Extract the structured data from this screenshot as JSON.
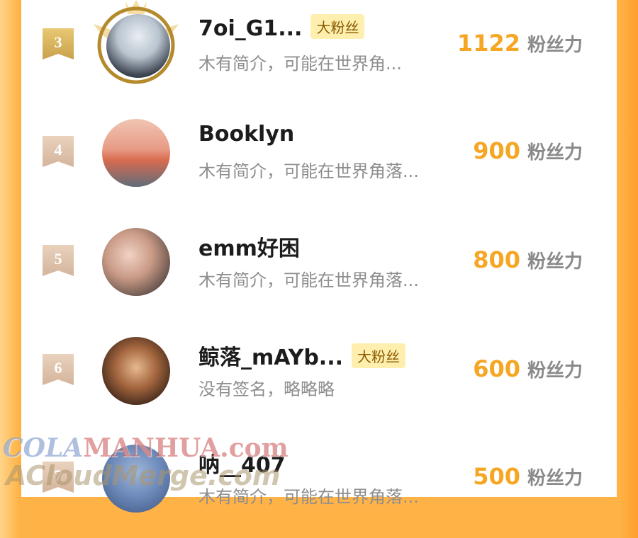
{
  "score_unit": "粉丝力",
  "badge_label": "大粉丝",
  "rows": [
    {
      "rank": "3",
      "name": "7oi_G1...",
      "bio": "木有简介，可能在世界角...",
      "score": "1122",
      "badge": true
    },
    {
      "rank": "4",
      "name": "Booklyn",
      "bio": "木有简介，可能在世界角落...",
      "score": "900",
      "badge": false
    },
    {
      "rank": "5",
      "name": "emm好困",
      "bio": "木有简介，可能在世界角落...",
      "score": "800",
      "badge": false
    },
    {
      "rank": "6",
      "name": "鲸落_mAYb...",
      "bio": "没有签名，略略略",
      "score": "600",
      "badge": true
    },
    {
      "rank": "7",
      "name": "呐__407",
      "bio": "木有简介，可能在世界角落...",
      "score": "500",
      "badge": false
    }
  ],
  "watermark": {
    "line1_a": "COLA",
    "line1_b": "MANHUA.com",
    "line2": "ACloudMerge.com"
  },
  "colors": {
    "score": "#f5a623",
    "gold_rank": "#c9a14c",
    "tan_rank": "#d4b49c",
    "badge_bg": "#ffefae",
    "side": "#ffb347"
  }
}
